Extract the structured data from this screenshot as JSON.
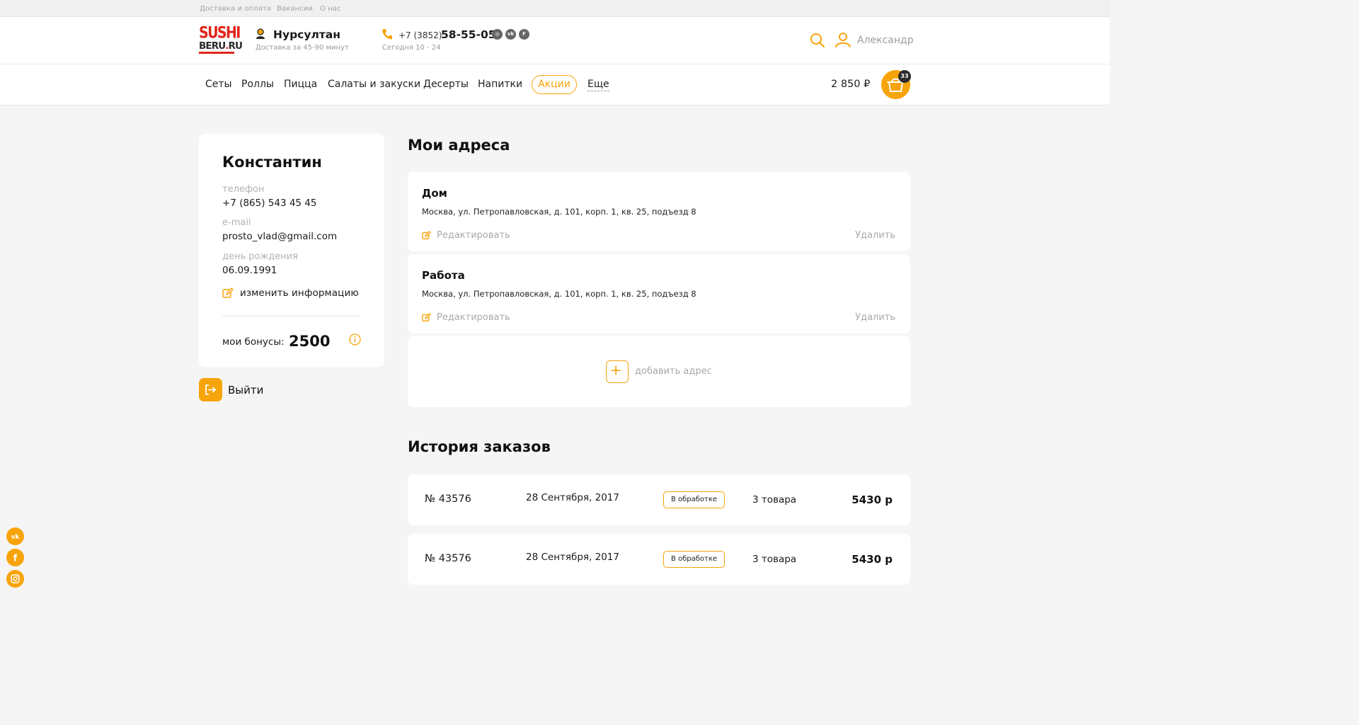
{
  "topbar": {
    "links": [
      "Доставка и оплата",
      "Вакансии",
      "О нас"
    ]
  },
  "header": {
    "logo_line1": "SUSHI",
    "logo_line2_a": "BERU",
    "logo_line2_dot": ".",
    "logo_line2_b": "RU",
    "city": "Нурсултан",
    "delivery": "Доставка за 45-90 минут",
    "phone_prefix": "+7 (3852)",
    "phone_number": "58-55-05",
    "hours": "Сегодня 10 - 24",
    "user_name": "Александр",
    "social_icons": [
      "instagram-icon",
      "vk-icon",
      "foursquare-icon"
    ]
  },
  "nav": {
    "items": [
      "Сеты",
      "Роллы",
      "Пицца",
      "Салаты и закуски",
      "Десерты",
      "Напитки"
    ],
    "promo": "Акции",
    "more": "Еще",
    "cart_total": "2 850 ₽",
    "cart_count": "33"
  },
  "profile": {
    "name": "Константин",
    "phone_label": "телефон",
    "phone": "+7 (865) 543 45 45",
    "email_label": "e-mail",
    "email": "prosto_vlad@gmail.com",
    "birthday_label": "день рождения",
    "birthday": "06.09.1991",
    "edit_label": "изменить информацию",
    "bonus_label": "мои бонусы:",
    "bonus_value": "2500",
    "logout": "Выйти"
  },
  "addresses": {
    "title": "Мои адреса",
    "items": [
      {
        "name": "Дом",
        "address": "Москва, ул. Петропавловская, д. 101, корп. 1, кв. 25, подъезд 8",
        "edit": "Редактировать",
        "delete": "Удалить"
      },
      {
        "name": "Работа",
        "address": "Москва, ул. Петропавловская, д. 101, корп. 1, кв. 25, подъезд 8",
        "edit": "Редактировать",
        "delete": "Удалить"
      }
    ],
    "add_label": "добавить адрес"
  },
  "orders": {
    "title": "История заказов",
    "items": [
      {
        "number": "№ 43576",
        "date": "28 Сентября, 2017",
        "status": "В обработке",
        "items": "3 товара",
        "sum": "5430 р"
      },
      {
        "number": "№ 43576",
        "date": "28 Сентября, 2017",
        "status": "В обработке",
        "items": "3 товара",
        "sum": "5430 р"
      }
    ]
  },
  "floating_social": [
    "vk-icon",
    "facebook-icon",
    "instagram-icon"
  ],
  "colors": {
    "accent": "#f7a30a",
    "logo_red": "#e2241b",
    "background": "#f5f5f5"
  }
}
